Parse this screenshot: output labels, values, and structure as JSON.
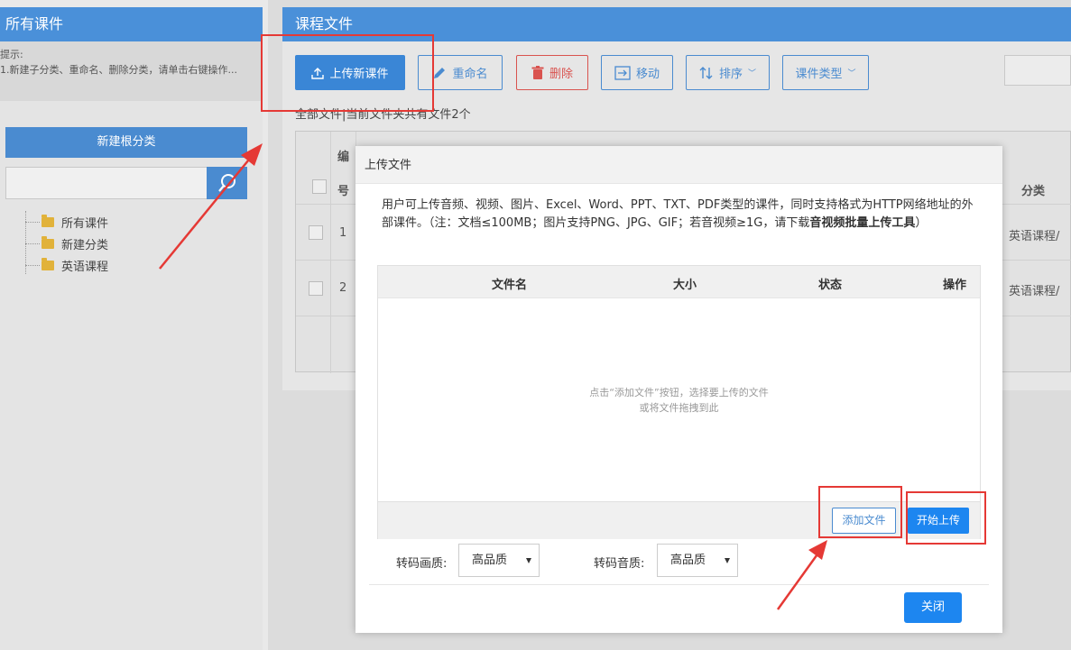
{
  "left_panel": {
    "title": "所有课件",
    "tip_line1": "提示:",
    "tip_line2": "1.新建子分类、重命名、删除分类，请单击右键操作...",
    "new_root_label": "新建根分类",
    "search_icon": "search-icon",
    "tree": [
      {
        "label": "所有课件",
        "icon": "folder-icon"
      },
      {
        "label": "新建分类",
        "icon": "folder-icon"
      },
      {
        "label": "英语课程",
        "icon": "folder-icon"
      }
    ]
  },
  "right_panel": {
    "title": "课程文件",
    "toolbar": {
      "upload_label": "上传新课件",
      "rename_label": "重命名",
      "delete_label": "删除",
      "move_label": "移动",
      "sort_label": "排序",
      "type_label": "课件类型"
    },
    "path_text": "全部文件|当前文件夹共有文件2个",
    "table": {
      "col_no_top": "编",
      "col_no_bottom": "号",
      "col_category": "分类",
      "rows": [
        {
          "no": "1",
          "category": "英语课程/"
        },
        {
          "no": "2",
          "category": "英语课程/"
        }
      ]
    }
  },
  "modal": {
    "title": "上传文件",
    "desc_part1": "用户可上传音频、视频、图片、Excel、Word、PPT、TXT、PDF类型的课件，同时支持格式为HTTP网络地址的外部课件。（注：文档≤100MB；图片支持PNG、JPG、GIF；若音视频≥1G，请下载",
    "desc_bold": "音视频批量上传工具",
    "desc_part2": "）",
    "columns": {
      "name": "文件名",
      "size": "大小",
      "status": "状态",
      "action": "操作"
    },
    "empty_line1": "点击“添加文件”按钮，选择要上传的文件",
    "empty_line2": "或将文件拖拽到此",
    "add_file_label": "添加文件",
    "start_upload_label": "开始上传",
    "video_quality_label": "转码画质:",
    "video_quality_value": "高品质",
    "audio_quality_label": "转码音质:",
    "audio_quality_value": "高品质",
    "close_label": "关闭"
  },
  "colors": {
    "header_blue": "#4a90d9",
    "primary_blue": "#1d86f0",
    "annotation_red": "#e53935"
  }
}
